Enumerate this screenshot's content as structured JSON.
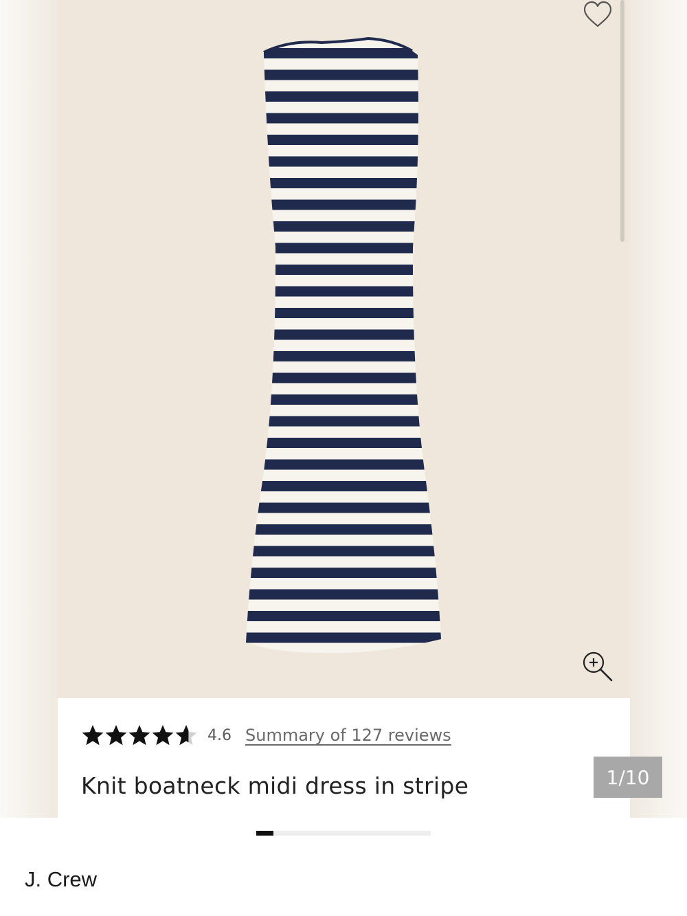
{
  "product": {
    "rating_value": "4.6",
    "rating": 4.6,
    "rating_max": 5,
    "reviews_link": "Summary of 127 reviews",
    "title": "Knit boatneck midi dress in stripe",
    "image_counter": "1/10",
    "gallery_position": 1,
    "gallery_total": 10
  },
  "brand": {
    "name": "J. Crew"
  },
  "icons": {
    "wishlist": "heart-outline-icon",
    "zoom": "zoom-in-icon",
    "star": "star-icon"
  },
  "colors": {
    "image_background": "#efe7dc",
    "stripe_navy": "#1f2a4d",
    "stripe_cream": "#f7f4ee",
    "star": "#111111",
    "counter_background": "#a8a8a8",
    "progress_active": "#111111"
  }
}
